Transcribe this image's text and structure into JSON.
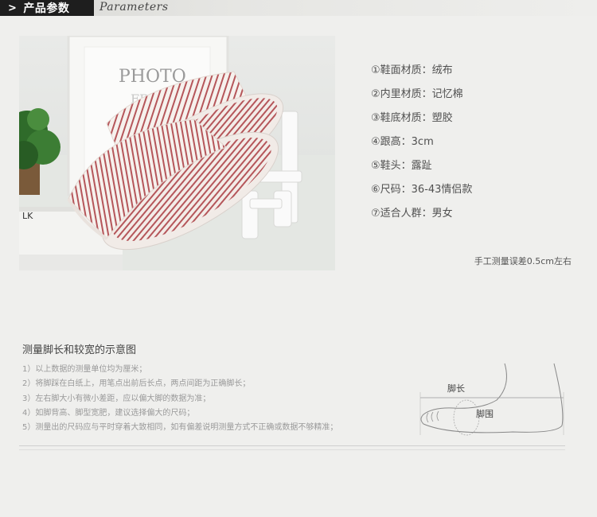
{
  "header": {
    "chevron": ">",
    "title": "产品参数",
    "title_en": "Parameters"
  },
  "product_image": {
    "frame_text_1": "PHOTO",
    "frame_text_2": "FRAME",
    "book_text": "LK"
  },
  "specs": [
    "①鞋面材质：绒布",
    "②内里材质：记忆棉",
    "③鞋底材质：塑胶",
    "④跟高：3cm",
    "⑤鞋头：露趾",
    "⑥尺码：36-43情侣款",
    "⑦适合人群：男女"
  ],
  "note": "手工测量误差0.5cm左右",
  "measure": {
    "title": "测量脚长和较宽的示意图",
    "steps": [
      "1）以上数据的测量单位均为厘米；",
      "2）将脚踩在白纸上，用笔点出前后长点，两点间距为正确脚长；",
      "3）左右脚大小有微小差距，应以偏大脚的数据为准；",
      "4）如脚背高、脚型宽肥，建议选择偏大的尺码；",
      "5）测量出的尺码应与平时穿着大致相同，如有偏差说明测量方式不正确或数据不够精准；"
    ],
    "diagram": {
      "length_label": "脚长",
      "girth_label": "脚围"
    }
  },
  "colors": {
    "background": "#efefed",
    "header_tag": "#1e1e1e",
    "stripe": "#b5565a"
  }
}
